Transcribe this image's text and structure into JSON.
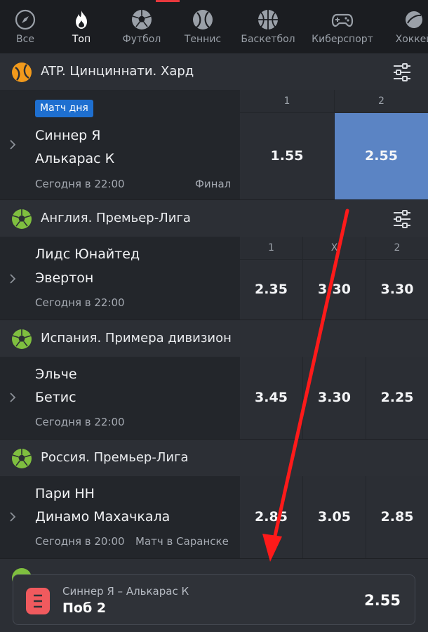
{
  "nav": {
    "items": [
      {
        "label": "Все",
        "icon": "compass-icon"
      },
      {
        "label": "Топ",
        "icon": "flame-icon"
      },
      {
        "label": "Футбол",
        "icon": "soccer-ball-icon"
      },
      {
        "label": "Теннис",
        "icon": "tennis-ball-icon"
      },
      {
        "label": "Баскетбол",
        "icon": "basketball-icon"
      },
      {
        "label": "Киберспорт",
        "icon": "gamepad-icon"
      },
      {
        "label": "Хоккей",
        "icon": "hockey-puck-icon"
      }
    ],
    "active": "Топ",
    "accent_color": "#e8383d"
  },
  "leagues": [
    {
      "name": "ATP. Цинциннати. Хард",
      "icon": "tennis-ball-icon",
      "has_filter": true,
      "odds_headers": [
        "1",
        "2"
      ],
      "match": {
        "badge": "Матч дня",
        "team1": "Синнер Я",
        "team2": "Алькарас К",
        "time": "Сегодня в 22:00",
        "note": "Финал",
        "odds": [
          "1.55",
          "2.55"
        ],
        "selected_index": 1
      }
    },
    {
      "name": "Англия. Премьер-Лига",
      "icon": "soccer-ball-icon",
      "has_filter": true,
      "odds_headers": [
        "1",
        "X",
        "2"
      ],
      "match": {
        "team1": "Лидс Юнайтед",
        "team2": "Эвертон",
        "time": "Сегодня в 22:00",
        "note": "",
        "odds": [
          "2.35",
          "3.30",
          "3.30"
        ]
      }
    },
    {
      "name": "Испания. Примера дивизион",
      "icon": "soccer-ball-icon",
      "match": {
        "team1": "Эльче",
        "team2": "Бетис",
        "time": "Сегодня в 22:00",
        "note": "",
        "odds": [
          "3.45",
          "3.30",
          "2.25"
        ]
      }
    },
    {
      "name": "Россия. Премьер-Лига",
      "icon": "soccer-ball-icon",
      "match": {
        "team1": "Пари НН",
        "team2": "Динамо Махачкала",
        "time": "Сегодня в 20:00",
        "note": "Матч в Саранске",
        "odds": [
          "2.85",
          "3.05",
          "2.85"
        ]
      }
    }
  ],
  "betslip": {
    "match": "Синнер Я – Алькарас К",
    "bet": "Поб 2",
    "odd": "2.55",
    "icon": "betslip-icon"
  },
  "colors": {
    "selected_odd": "#5b84c4",
    "badge": "#1e6fd0",
    "annotation_arrow": "#ff1a1a"
  }
}
